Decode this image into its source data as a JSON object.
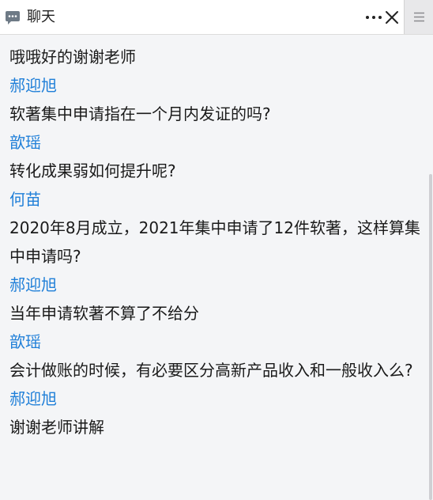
{
  "header": {
    "title": "聊天",
    "icons": {
      "chat": "chat-bubble-icon",
      "more": "more-horizontal-icon",
      "close": "close-icon",
      "menu": "hamburger-menu-icon"
    }
  },
  "messages": [
    {
      "kind": "text",
      "text": "哦哦好的谢谢老师"
    },
    {
      "kind": "sender",
      "text": "郝迎旭"
    },
    {
      "kind": "text",
      "text": "软著集中申请指在一个月内发证的吗?"
    },
    {
      "kind": "sender",
      "text": "歆瑶"
    },
    {
      "kind": "text",
      "text": "转化成果弱如何提升呢?"
    },
    {
      "kind": "sender",
      "text": "何苗"
    },
    {
      "kind": "text",
      "text": "2020年8月成立，2021年集中申请了12件软著，这样算集中申请吗?"
    },
    {
      "kind": "sender",
      "text": "郝迎旭"
    },
    {
      "kind": "text",
      "text": "当年申请软著不算了不给分"
    },
    {
      "kind": "sender",
      "text": "歆瑶"
    },
    {
      "kind": "text",
      "text": "会计做账的时候，有必要区分高新产品收入和一般收入么?"
    },
    {
      "kind": "sender",
      "text": "郝迎旭"
    },
    {
      "kind": "text",
      "text": "谢谢老师讲解"
    }
  ],
  "colors": {
    "sender": "#1f7fd8",
    "text": "#1a1a1a",
    "background": "#f4f5f7"
  }
}
